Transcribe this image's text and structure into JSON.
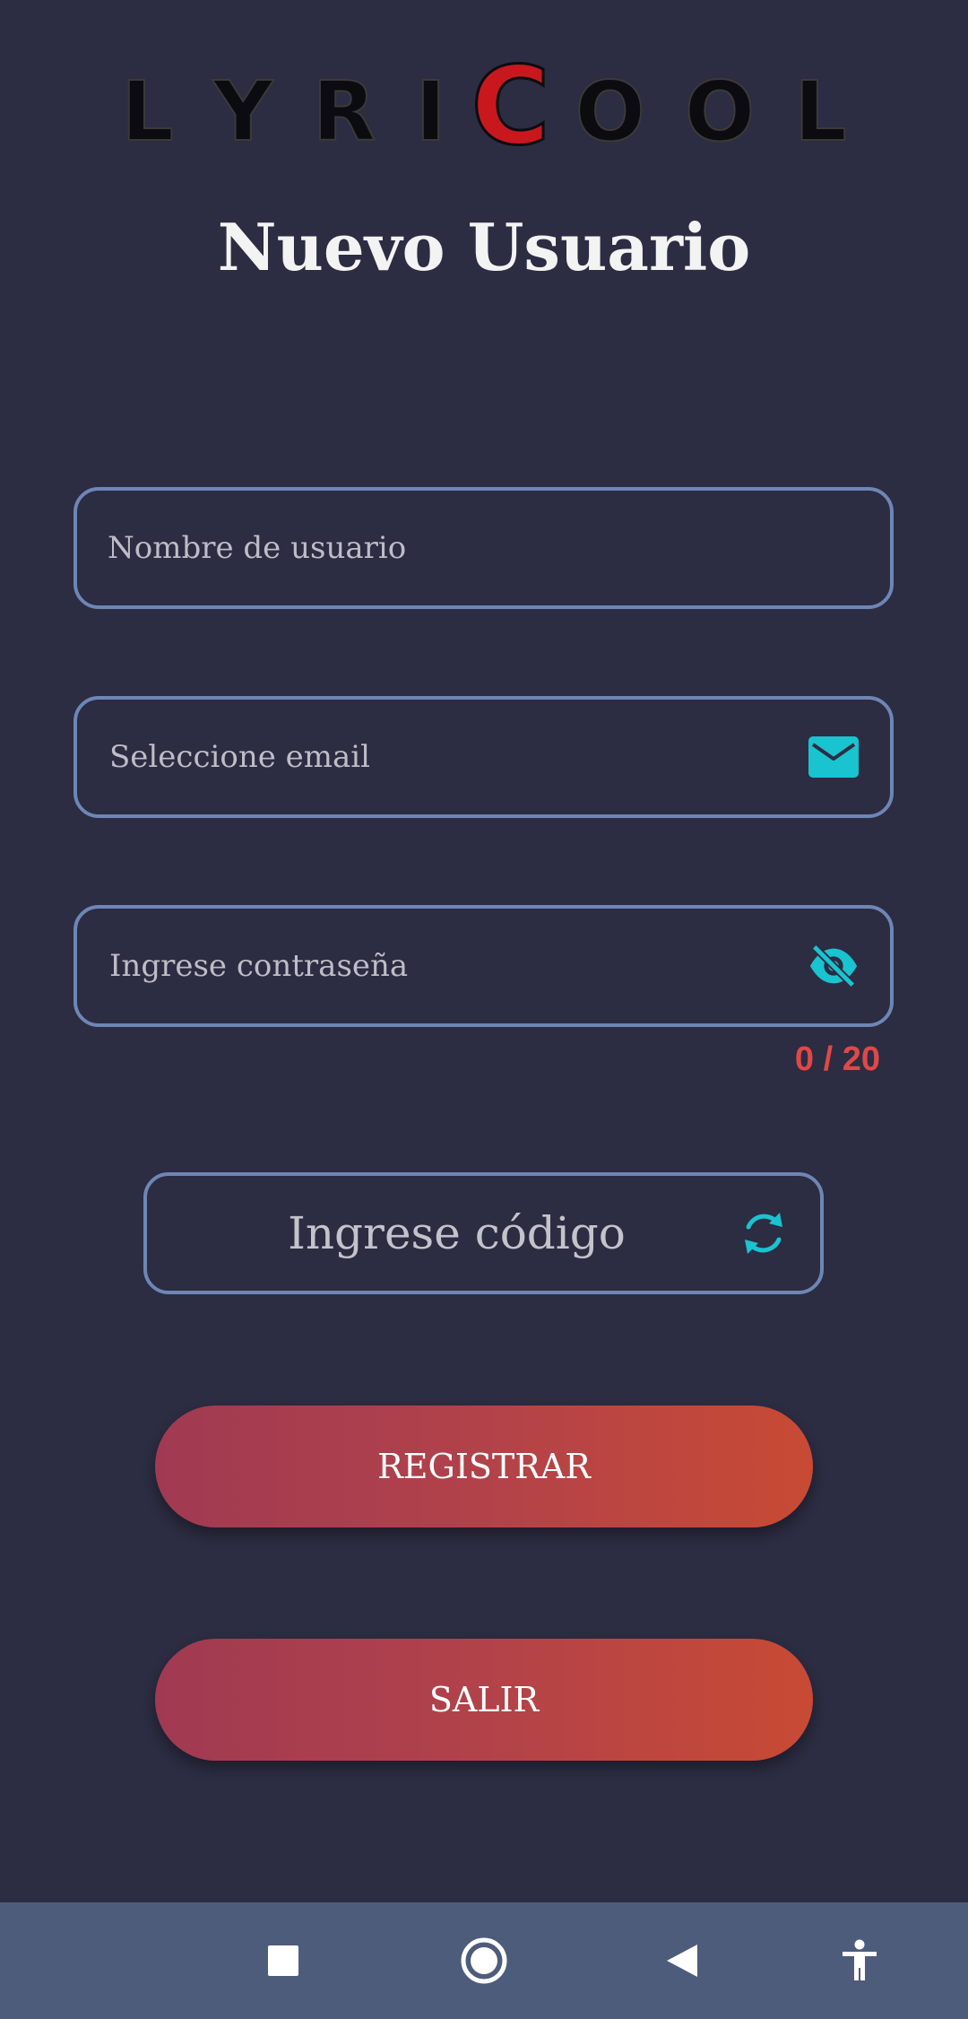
{
  "app": {
    "logo_letters": [
      "L",
      "Y",
      "R",
      "I",
      "C",
      "O",
      "O",
      "L"
    ],
    "logo_text": "LYRICOOL"
  },
  "page": {
    "title": "Nuevo Usuario"
  },
  "form": {
    "username": {
      "placeholder": "Nombre de usuario",
      "value": ""
    },
    "email": {
      "placeholder": "Seleccione email",
      "value": "",
      "icon": "email-icon"
    },
    "password": {
      "placeholder": "Ingrese contraseña",
      "value": "",
      "icon": "visibility-off-icon",
      "counter": "0 / 20"
    },
    "code": {
      "placeholder": "Ingrese código",
      "value": "",
      "icon": "refresh-icon"
    }
  },
  "buttons": {
    "register_label": "REGISTRAR",
    "exit_label": "SALIR"
  },
  "navbar": {
    "items": [
      "recents-icon",
      "home-icon",
      "back-icon",
      "accessibility-icon"
    ]
  },
  "colors": {
    "background": "#2c2c42",
    "field_border": "#6e86b5",
    "icon_accent": "#19c3cf",
    "counter": "#e04848",
    "button_gradient_start": "#a03a52",
    "button_gradient_end": "#c84a34",
    "navbar": "#4e5c7c",
    "logo_accent": "#c8181e"
  }
}
